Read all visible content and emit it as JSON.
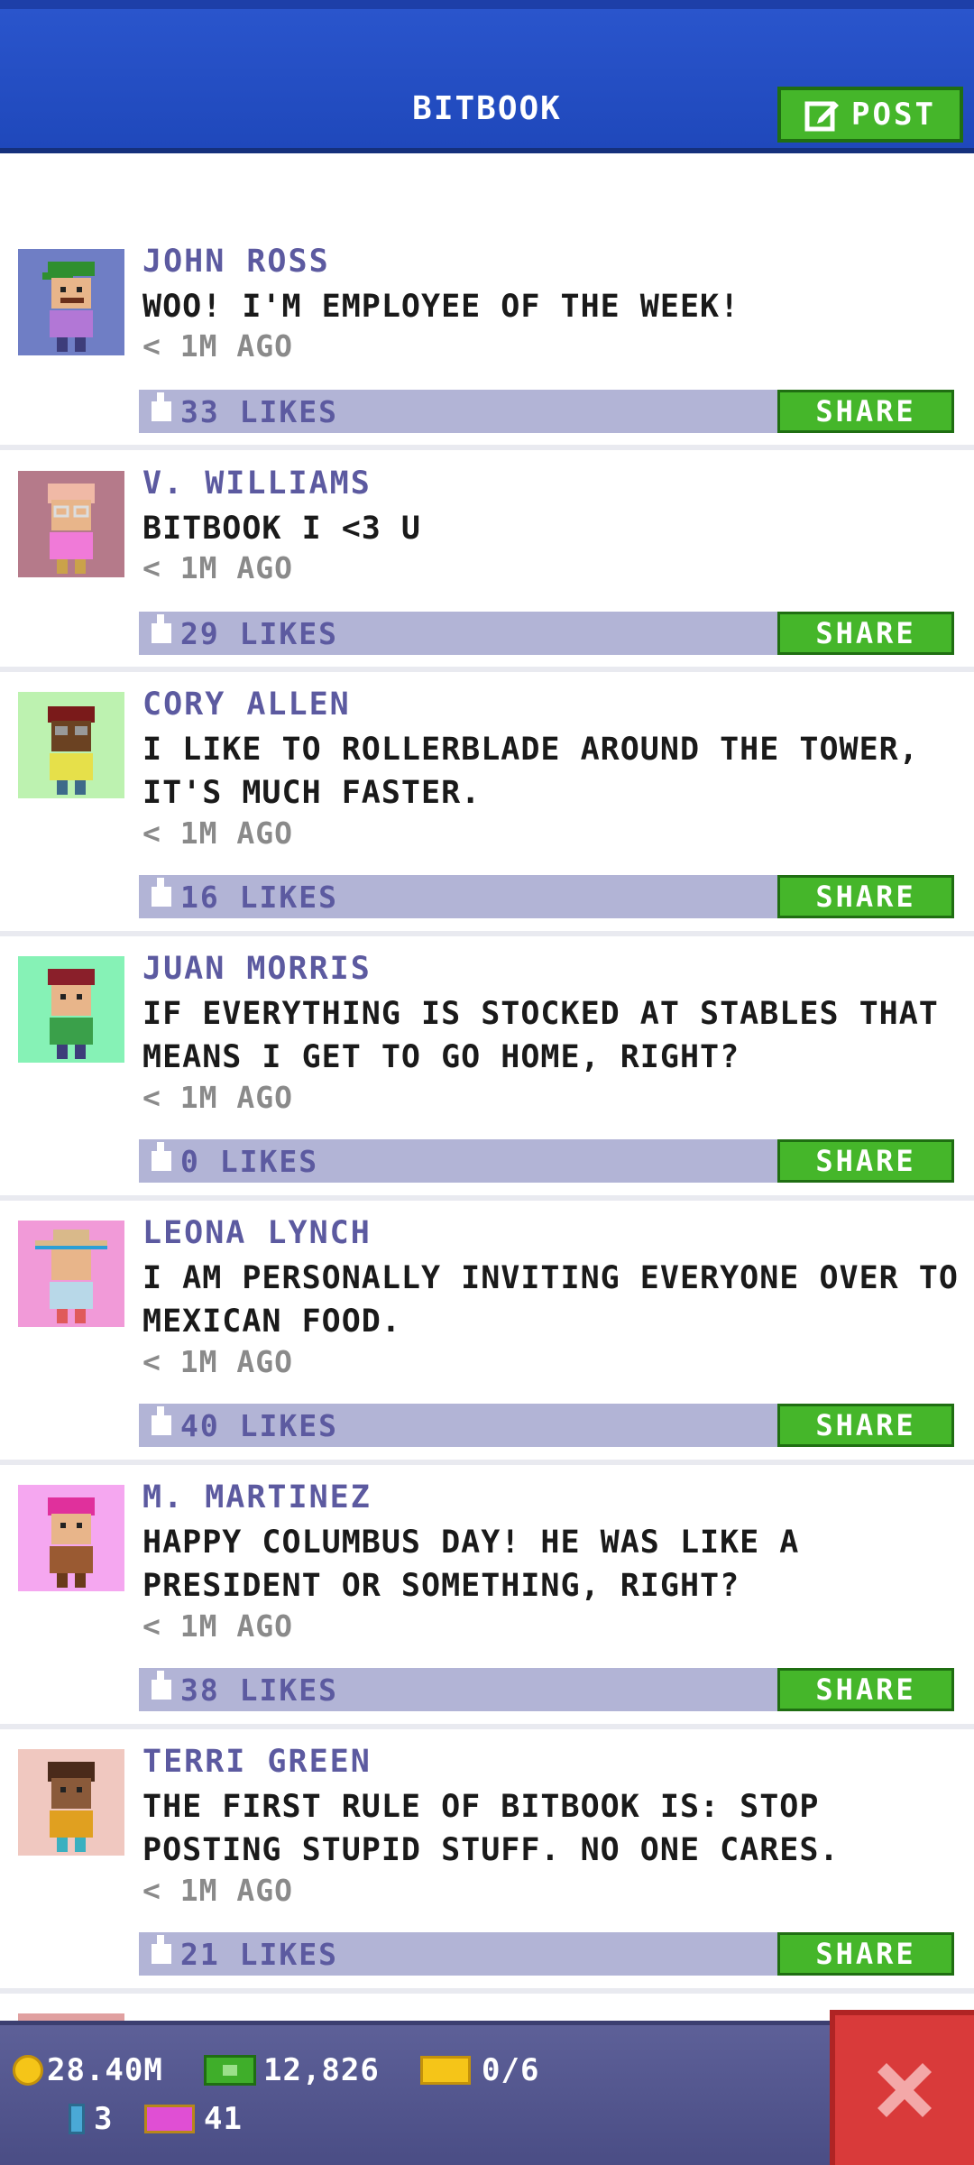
{
  "header": {
    "title": "BITBOOK",
    "post_label": "POST"
  },
  "posts": [
    {
      "name": "JOHN ROSS",
      "message": "WOO! I'M EMPLOYEE OF THE WEEK!",
      "time": "< 1M AGO",
      "likes": "33 LIKES",
      "share": "SHARE",
      "avatar_bg": "#6f7ec5"
    },
    {
      "name": "V. WILLIAMS",
      "message": "BITBOOK I <3 U",
      "time": "< 1M AGO",
      "likes": "29 LIKES",
      "share": "SHARE",
      "avatar_bg": "#b57a8a"
    },
    {
      "name": "CORY ALLEN",
      "message": "I LIKE TO ROLLERBLADE AROUND THE TOWER, IT'S MUCH FASTER.",
      "time": "< 1M AGO",
      "likes": "16 LIKES",
      "share": "SHARE",
      "avatar_bg": "#bdf2b0"
    },
    {
      "name": "JUAN MORRIS",
      "message": "IF EVERYTHING IS STOCKED AT STABLES THAT MEANS I GET TO GO HOME, RIGHT?",
      "time": "< 1M AGO",
      "likes": "0 LIKES",
      "share": "SHARE",
      "avatar_bg": "#86f2b6"
    },
    {
      "name": "LEONA LYNCH",
      "message": "I AM PERSONALLY INVITING EVERYONE OVER TO MEXICAN FOOD.",
      "time": "< 1M AGO",
      "likes": "40 LIKES",
      "share": "SHARE",
      "avatar_bg": "#f19ad8"
    },
    {
      "name": "M. MARTINEZ",
      "message": "HAPPY COLUMBUS DAY! HE WAS LIKE A PRESIDENT OR SOMETHING, RIGHT?",
      "time": "< 1M AGO",
      "likes": "38 LIKES",
      "share": "SHARE",
      "avatar_bg": "#f5a7f0"
    },
    {
      "name": "TERRI GREEN",
      "message": "THE FIRST RULE OF BITBOOK IS: STOP POSTING STUPID STUFF. NO ONE CARES.",
      "time": "< 1M AGO",
      "likes": "21 LIKES",
      "share": "SHARE",
      "avatar_bg": "#f0c8c0"
    }
  ],
  "footer": {
    "coins": "28.40M",
    "bux": "12,826",
    "tickets": "0/6",
    "bitbook_count": "3",
    "vip": "41"
  },
  "colors": {
    "header": "#1f48bb",
    "accent_green": "#45b62a",
    "like_bar": "#b2b4d6",
    "name": "#5c5aa0",
    "close": "#d93a3a"
  },
  "icons": [
    "edit-icon",
    "thumbs-up-icon",
    "coin-icon",
    "cash-icon",
    "ticket-icon",
    "bitbook-icon",
    "vip-icon",
    "close-icon"
  ]
}
